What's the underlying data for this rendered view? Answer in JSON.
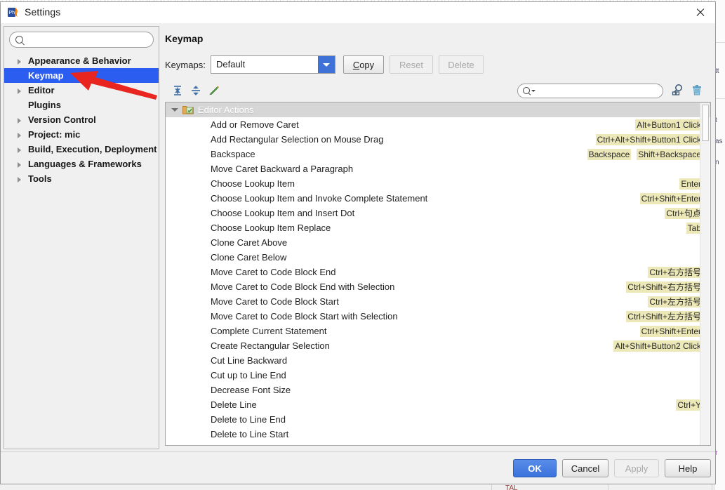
{
  "window": {
    "title": "Settings",
    "app_icon": "phpstorm-icon",
    "close_icon": "close-icon"
  },
  "sidebar": {
    "search": {
      "value": "",
      "placeholder": "",
      "icon": "search-icon"
    },
    "items": [
      {
        "label": "Appearance & Behavior",
        "expandable": true,
        "selected": false
      },
      {
        "label": "Keymap",
        "expandable": false,
        "selected": true
      },
      {
        "label": "Editor",
        "expandable": true,
        "selected": false
      },
      {
        "label": "Plugins",
        "expandable": false,
        "selected": false
      },
      {
        "label": "Version Control",
        "expandable": true,
        "selected": false
      },
      {
        "label": "Project: mic",
        "expandable": true,
        "selected": false
      },
      {
        "label": "Build, Execution, Deployment",
        "expandable": true,
        "selected": false
      },
      {
        "label": "Languages & Frameworks",
        "expandable": true,
        "selected": false
      },
      {
        "label": "Tools",
        "expandable": true,
        "selected": false
      }
    ]
  },
  "main": {
    "title": "Keymap",
    "keymaps_label": "Keymaps:",
    "keymap_selected": "Default",
    "keymap_options": [
      "Default"
    ],
    "buttons": {
      "copy": "Copy",
      "copy_mnemonic": "C",
      "reset": "Reset",
      "delete": "Delete"
    },
    "toolbar_icons": [
      "expand-all-icon",
      "collapse-all-icon",
      "edit-shortcut-icon"
    ],
    "action_search": {
      "value": "",
      "placeholder": "",
      "icon": "search-icon"
    },
    "right_icons": [
      "find-by-shortcut-icon",
      "clear-filter-icon"
    ]
  },
  "list": {
    "group": {
      "label": "Editor Actions",
      "expanded": true,
      "icon": "folder-icon"
    },
    "rows": [
      {
        "name": "Add or Remove Caret",
        "shortcuts": [
          "Alt+Button1 Click"
        ]
      },
      {
        "name": "Add Rectangular Selection on Mouse Drag",
        "shortcuts": [
          "Ctrl+Alt+Shift+Button1 Click"
        ]
      },
      {
        "name": "Backspace",
        "shortcuts": [
          "Backspace",
          "Shift+Backspace"
        ]
      },
      {
        "name": "Move Caret Backward a Paragraph",
        "shortcuts": []
      },
      {
        "name": "Choose Lookup Item",
        "shortcuts": [
          "Enter"
        ]
      },
      {
        "name": "Choose Lookup Item and Invoke Complete Statement",
        "shortcuts": [
          "Ctrl+Shift+Enter"
        ]
      },
      {
        "name": "Choose Lookup Item and Insert Dot",
        "shortcuts": [
          "Ctrl+句点"
        ]
      },
      {
        "name": "Choose Lookup Item Replace",
        "shortcuts": [
          "Tab"
        ]
      },
      {
        "name": "Clone Caret Above",
        "shortcuts": []
      },
      {
        "name": "Clone Caret Below",
        "shortcuts": []
      },
      {
        "name": "Move Caret to Code Block End",
        "shortcuts": [
          "Ctrl+右方括号"
        ]
      },
      {
        "name": "Move Caret to Code Block End with Selection",
        "shortcuts": [
          "Ctrl+Shift+右方括号"
        ]
      },
      {
        "name": "Move Caret to Code Block Start",
        "shortcuts": [
          "Ctrl+左方括号"
        ]
      },
      {
        "name": "Move Caret to Code Block Start with Selection",
        "shortcuts": [
          "Ctrl+Shift+左方括号"
        ]
      },
      {
        "name": "Complete Current Statement",
        "shortcuts": [
          "Ctrl+Shift+Enter"
        ]
      },
      {
        "name": "Create Rectangular Selection",
        "shortcuts": [
          "Alt+Shift+Button2 Click"
        ]
      },
      {
        "name": "Cut Line Backward",
        "shortcuts": []
      },
      {
        "name": "Cut up to Line End",
        "shortcuts": []
      },
      {
        "name": "Decrease Font Size",
        "shortcuts": []
      },
      {
        "name": "Delete Line",
        "shortcuts": [
          "Ctrl+Y"
        ]
      },
      {
        "name": "Delete to Line End",
        "shortcuts": []
      },
      {
        "name": "Delete to Line Start",
        "shortcuts": []
      }
    ]
  },
  "footer": {
    "ok": "OK",
    "cancel": "Cancel",
    "apply": "Apply",
    "help": "Help"
  },
  "annotation": {
    "arrow": "red-arrow-pointing-to-keymap",
    "color": "#e8251f"
  },
  "colors": {
    "selection_blue": "#2b5df0",
    "primary_button": "#3a72dd",
    "shortcut_highlight": "#ece8b8",
    "group_header": "#d6d6d6"
  }
}
